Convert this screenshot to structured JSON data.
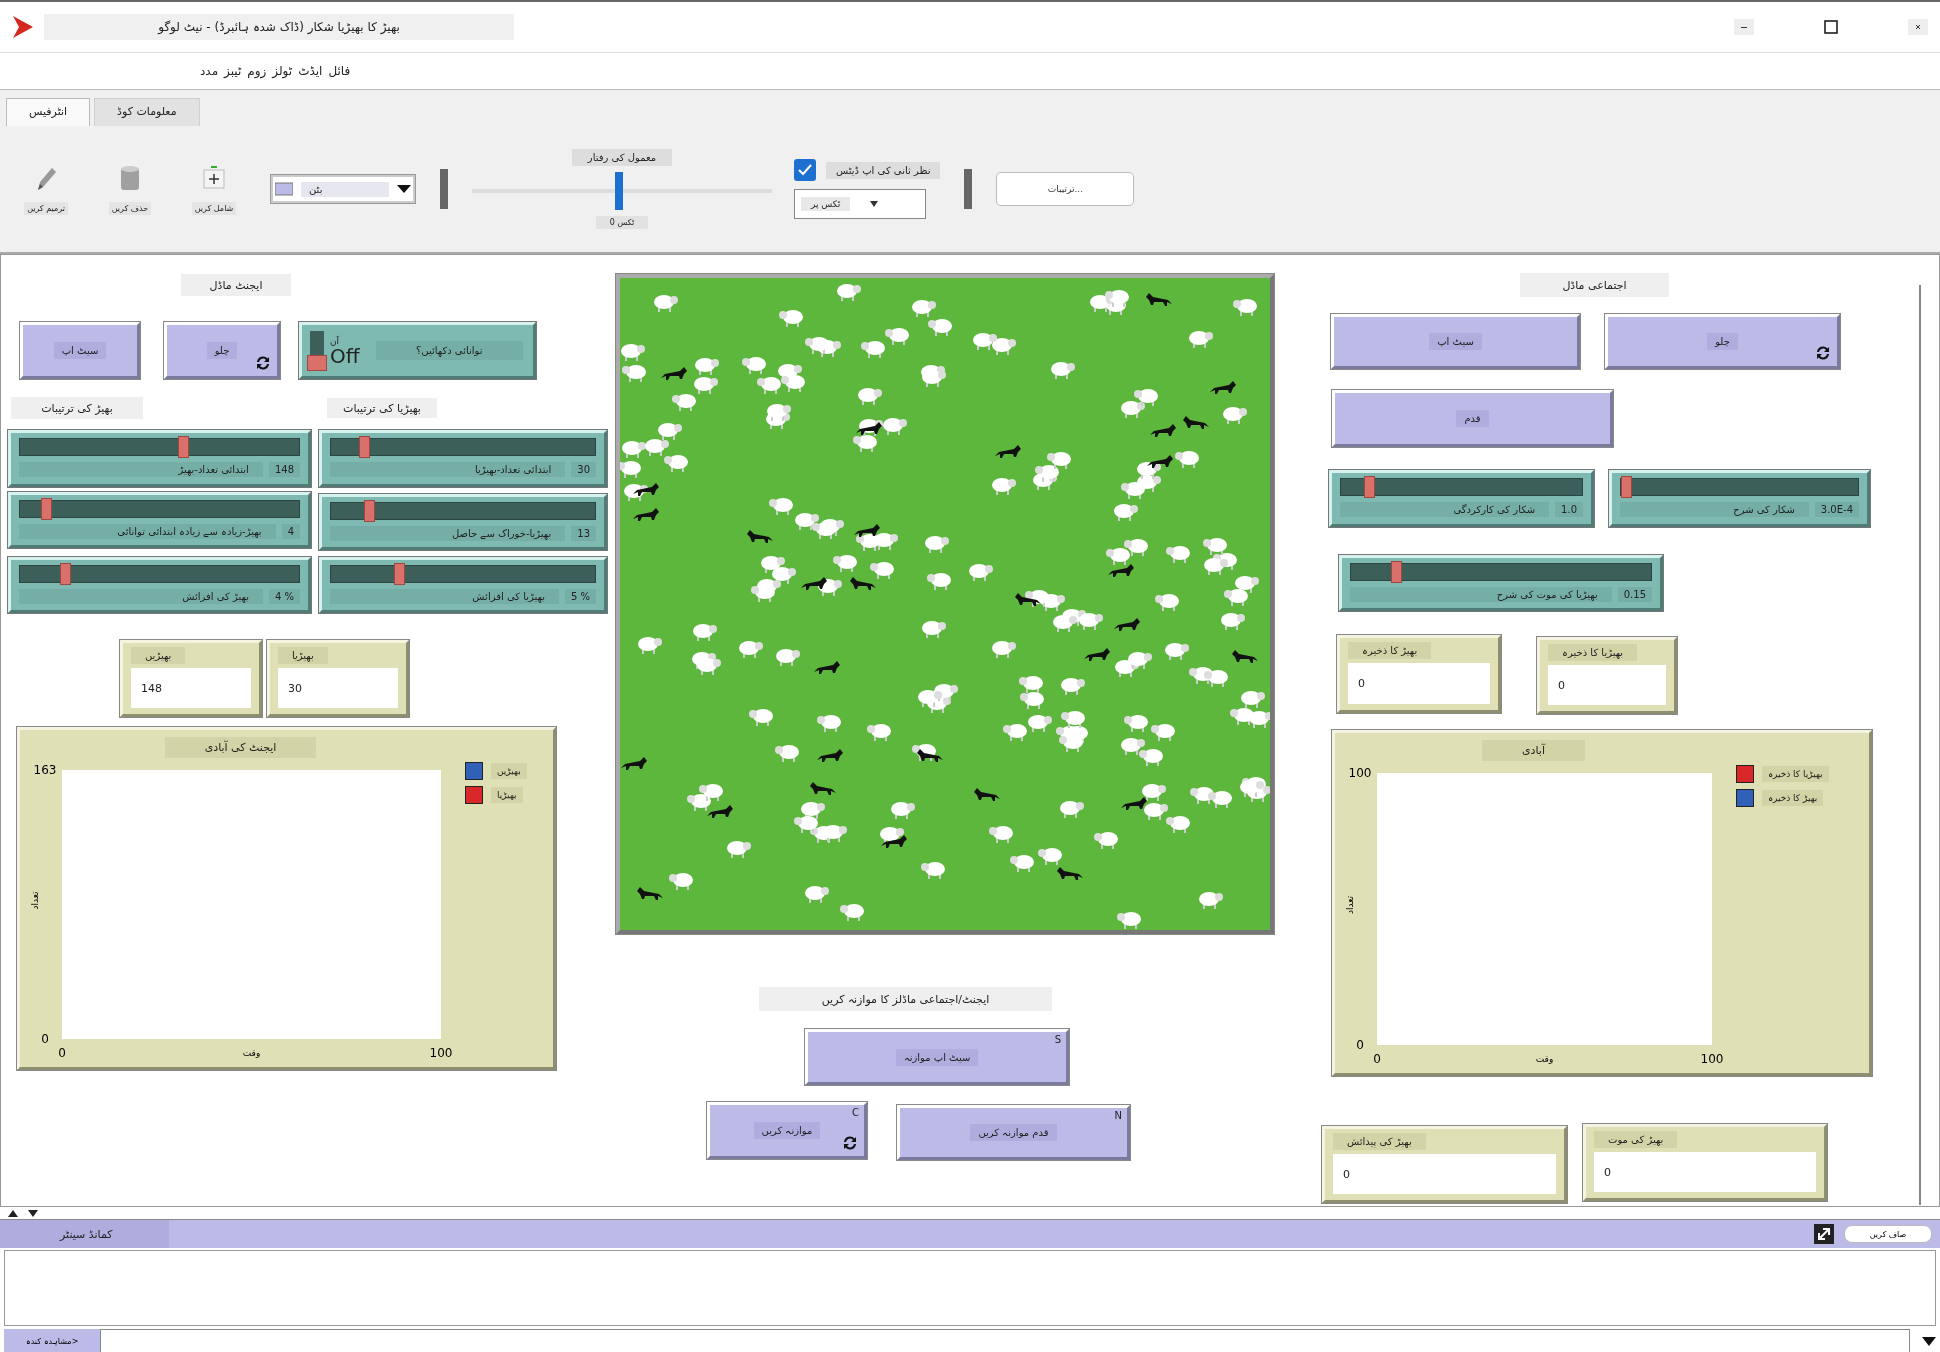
{
  "window": {
    "title": "بھیڑ کا بھیڑیا شکار (ڈاک شدہ ہائبرڈ) - نیٹ لوگو"
  },
  "menu": [
    "فائل",
    "ایڈٹ",
    "ٹولز",
    "زوم",
    "ٹیبز",
    "مدد"
  ],
  "tabs": [
    {
      "label": "معلومات کوڈ",
      "selected": false
    },
    {
      "label": "انٹرفیس",
      "selected": true
    }
  ],
  "toolbar": {
    "tools": [
      {
        "kind": "add",
        "label": "شامل کریں"
      },
      {
        "kind": "delete",
        "label": "حذف کریں"
      },
      {
        "kind": "edit",
        "label": "ترمیم کریں"
      }
    ],
    "widget_picker": {
      "value": "بٹن"
    },
    "speed": {
      "label": "معمول کی رفتار",
      "level": 0.49,
      "ticks": "ٹکس 0"
    },
    "view_updates": {
      "label": "نظر ثانی کی اپ ڈیٹس",
      "checked": true
    },
    "update_mode": {
      "value": "ٹکس پر"
    },
    "settings_button": "ترتیبات..."
  },
  "widgets": [
    {
      "kind": "note",
      "text": "اجتماعی ماڈل"
    },
    {
      "kind": "view"
    },
    {
      "kind": "note",
      "text": "ایجنٹ ماڈل"
    },
    {
      "kind": "button",
      "label": "چلو",
      "forever": true
    },
    {
      "kind": "button",
      "label": "سیٹ اپ",
      "forever": false
    },
    {
      "kind": "switch",
      "label": "توانائی دکھائیں؟",
      "on": false,
      "on_text": "آن",
      "off_text": "Off"
    },
    {
      "kind": "button",
      "label": "چلو",
      "forever": true
    },
    {
      "kind": "button",
      "label": "سیٹ اپ",
      "forever": false
    },
    {
      "kind": "button",
      "label": "قدم",
      "forever": false
    },
    {
      "kind": "note",
      "text": "بھیڑیا کی ترتیبات"
    },
    {
      "kind": "note",
      "text": "بھیڑ کی ترتیبات"
    },
    {
      "kind": "slider",
      "label": "ابتدائی تعداد-بھیڑیا",
      "value": "30",
      "level": 0.11
    },
    {
      "kind": "slider",
      "label": "ابتدائی تعداد-بھیڑ",
      "value": "148",
      "level": 0.59
    },
    {
      "kind": "slider",
      "label": "شکار کی شرح",
      "value": "3.0E-4",
      "level": 0.0
    },
    {
      "kind": "slider",
      "label": "شکار کی کارکردگی",
      "value": "1.0",
      "level": 0.1
    },
    {
      "kind": "slider",
      "label": "بھیڑیا-خوراک سے حاصل",
      "value": "13",
      "level": 0.13
    },
    {
      "kind": "slider",
      "label": "بھیڑ-زیادہ سے زیادہ ابتدائی توانائی",
      "value": "4",
      "level": 0.08
    },
    {
      "kind": "slider",
      "label": "بھیڑیا کی موت کی شرح",
      "value": "0.15",
      "level": 0.14
    },
    {
      "kind": "slider",
      "label": "بھیڑیا کی افزائش",
      "value": "5 %",
      "level": 0.25
    },
    {
      "kind": "slider",
      "label": "بھیڑ کی افزائش",
      "value": "4 %",
      "level": 0.15
    },
    {
      "kind": "monitor",
      "label": "بھیڑیا کا ذخیرہ",
      "value": "0"
    },
    {
      "kind": "monitor",
      "label": "بھیڑ کا ذخیرہ",
      "value": "0"
    },
    {
      "kind": "monitor",
      "label": "بھیڑیا",
      "value": "30"
    },
    {
      "kind": "monitor",
      "label": "بھیڑیں",
      "value": "148"
    },
    {
      "kind": "plot",
      "title": "آبادی",
      "y_max": "100",
      "y_min": "0",
      "x_min": "0",
      "x_max": "100",
      "xlabel": "وقت",
      "ylabel": "تعداد",
      "legend": [
        {
          "name": "بھیڑیا کا ذخیرہ",
          "color": "#d8282a"
        },
        {
          "name": "بھیڑ کا ذخیرہ",
          "color": "#3060b8"
        }
      ]
    },
    {
      "kind": "plot",
      "title": "ایجنٹ کی آبادی",
      "y_max": "163",
      "y_min": "0",
      "x_min": "0",
      "x_max": "100",
      "xlabel": "وقت",
      "ylabel": "تعداد",
      "legend": [
        {
          "name": "بھیڑیں",
          "color": "#3060b8"
        },
        {
          "name": "بھیڑیا",
          "color": "#d8282a"
        }
      ]
    },
    {
      "kind": "note",
      "text": "ایجنٹ/اجتماعی ماڈلز کا موازنہ کریں"
    },
    {
      "kind": "button",
      "label": "سیٹ اپ موازنہ",
      "forever": false,
      "key": "S"
    },
    {
      "kind": "monitor",
      "label": "بھیڑ کی موت",
      "value": "0"
    },
    {
      "kind": "monitor",
      "label": "بھیڑ کی پیدائش",
      "value": "0"
    },
    {
      "kind": "button",
      "label": "قدم موازنہ کریں",
      "forever": false,
      "key": "N"
    },
    {
      "kind": "button",
      "label": "موازنہ کریں",
      "forever": true,
      "key": "C"
    }
  ],
  "command_center": {
    "title": "کمانڈ سینٹر",
    "clear_button": "صاف کریں",
    "prompt": "مشاہدہ کندہ>"
  }
}
